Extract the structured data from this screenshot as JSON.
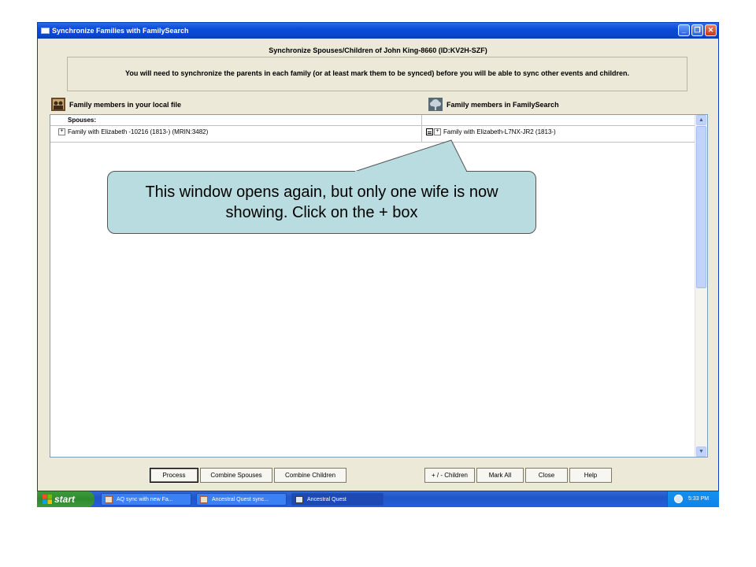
{
  "window": {
    "title": "Synchronize Families with FamilySearch",
    "heading": "Synchronize Spouses/Children of John King-8660  (ID:KV2H-SZF)",
    "notice": "You will need to synchronize the parents in each family (or at least mark them to be synced) before you will be able to sync other events and children."
  },
  "panes": {
    "local_label": "Family members in your local file",
    "fs_label": "Family members in FamilySearch"
  },
  "list": {
    "section_label": "Spouses:",
    "local_family": "Family with Elizabeth -10216 (1813-) (MRIN:3482)",
    "fs_family": "Family with Elizabeth-L7NX-JR2 (1813-)"
  },
  "buttons": {
    "process": "Process",
    "combine_spouses": "Combine Spouses",
    "combine_children": "Combine Children",
    "plus_minus_children": "+ / - Children",
    "mark_all": "Mark All",
    "close": "Close",
    "help": "Help"
  },
  "callout": {
    "text": "This window opens again, but only one wife is now showing.  Click on the + box"
  },
  "taskbar": {
    "start": "start",
    "tasks": [
      "AQ sync with new Fa...",
      "Ancestral Quest sync...",
      "Ancestral Quest"
    ],
    "time": "5:33 PM"
  },
  "colors": {
    "title_bar": "#0a4bd6",
    "callout_fill": "#b9dce0",
    "taskbar": "#245edb",
    "start_green": "#3c9b3c"
  },
  "icons": {
    "minimize": "minimize-icon",
    "restore": "restore-icon",
    "close": "close-icon",
    "expand": "plus-box-icon"
  }
}
